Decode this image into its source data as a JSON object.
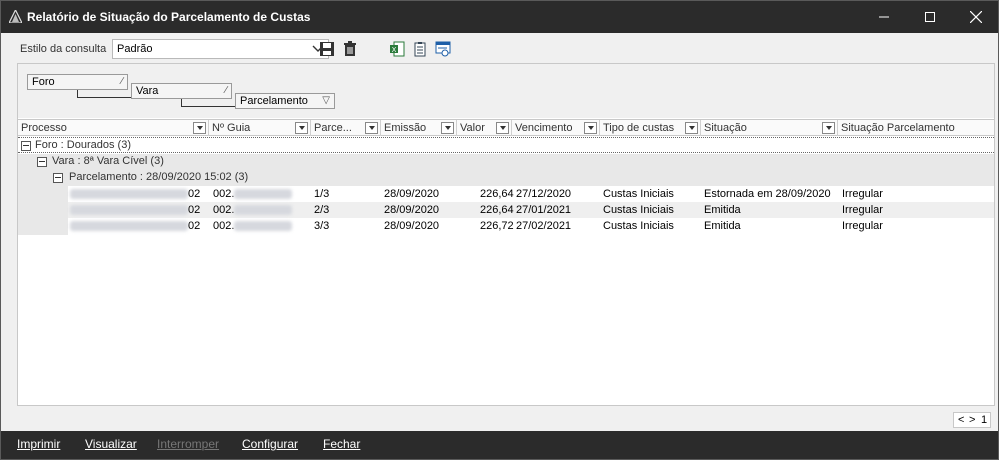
{
  "window": {
    "title": "Relatório de Situação do Parcelamento de Custas"
  },
  "toolbar": {
    "style_label": "Estilo da consulta",
    "style_value": "Padrão"
  },
  "group_panel": {
    "items": [
      "Foro",
      "Vara",
      "Parcelamento"
    ]
  },
  "columns": [
    "Processo",
    "Nº Guia",
    "Parce...",
    "Emissão",
    "Valor",
    "Vencimento",
    "Tipo de custas",
    "Situação",
    "Situação Parcelamento"
  ],
  "groups": {
    "foro": "Foro : Dourados (3)",
    "vara": "Vara : 8ª Vara Cível (3)",
    "parcelamento": "Parcelamento : 28/09/2020 15:02 (3)"
  },
  "rows": [
    {
      "processo_suffix": "02",
      "guia_prefix": "002.",
      "parcela": "1/3",
      "emissao": "28/09/2020",
      "valor": "226,64",
      "vencimento": "27/12/2020",
      "tipo": "Custas Iniciais",
      "situacao": "Estornada em 28/09/2020",
      "situacao_parcelamento": "Irregular"
    },
    {
      "processo_suffix": "02",
      "guia_prefix": "002.",
      "parcela": "2/3",
      "emissao": "28/09/2020",
      "valor": "226,64",
      "vencimento": "27/01/2021",
      "tipo": "Custas Iniciais",
      "situacao": "Emitida",
      "situacao_parcelamento": "Irregular"
    },
    {
      "processo_suffix": "02",
      "guia_prefix": "002.",
      "parcela": "3/3",
      "emissao": "28/09/2020",
      "valor": "226,72",
      "vencimento": "27/02/2021",
      "tipo": "Custas Iniciais",
      "situacao": "Emitida",
      "situacao_parcelamento": "Irregular"
    }
  ],
  "pager": {
    "prev": "<",
    "next": ">",
    "page": "1"
  },
  "bottom_buttons": {
    "imprimir": "Imprimir",
    "visualizar": "Visualizar",
    "interromper": "Interromper",
    "configurar": "Configurar",
    "fechar": "Fechar"
  },
  "icons": [
    "app-icon",
    "minimize-icon",
    "maximize-icon",
    "close-icon",
    "save-icon",
    "delete-icon",
    "export-excel-icon",
    "copy-icon",
    "preview-icon"
  ]
}
